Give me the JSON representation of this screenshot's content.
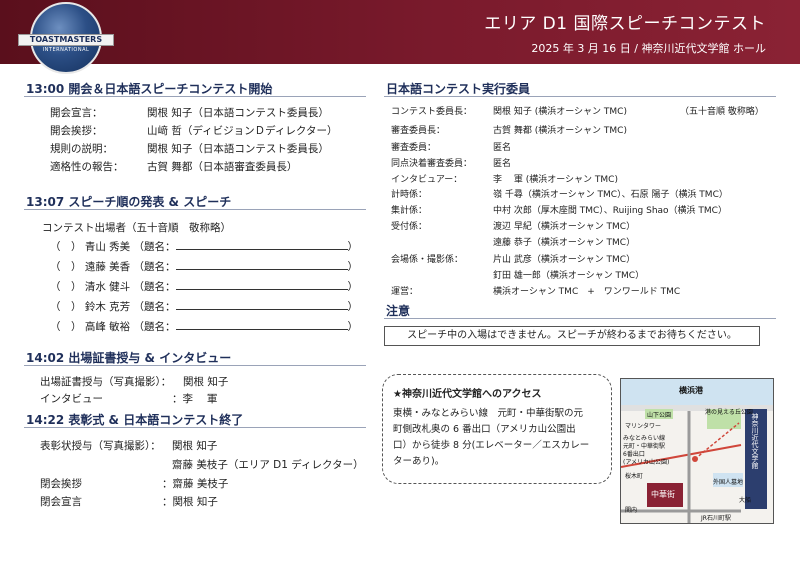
{
  "header": {
    "title": "エリア D1  国際スピーチコンテスト",
    "subtitle": "2025 年 3 月 16 日  /  神奈川近代文学館  ホール",
    "logo_text": "TOASTMASTERS",
    "logo_sub": "INTERNATIONAL"
  },
  "colors": {
    "header_bg": "#6a1424",
    "section_title": "#1f2f5a"
  },
  "opening": {
    "title": "13:00  開会＆日本語スピーチコンテスト開始",
    "items": [
      {
        "role": "開会宣言：",
        "person": "関根 知子（日本語コンテスト委員長）"
      },
      {
        "role": "開会挨拶：",
        "person": "山﨑  哲（ディビジョンＤディレクター）"
      },
      {
        "role": "規則の説明：",
        "person": "関根 知子（日本語コンテスト委員長）"
      },
      {
        "role": "適格性の報告：",
        "person": "古賀 舞都（日本語審査委員長）"
      }
    ]
  },
  "speech": {
    "title": "13:07  スピーチ順の発表 & スピーチ",
    "intro": "コンテスト出場者（五十音順　敬称略）",
    "contestants": [
      {
        "prefix": "（　）",
        "name": "青山 秀美",
        "label": "（題名：",
        "suffix": "）"
      },
      {
        "prefix": "（　）",
        "name": "遠藤 美香",
        "label": "（題名：",
        "suffix": "）"
      },
      {
        "prefix": "（　）",
        "name": "清水 健斗",
        "label": "（題名：",
        "suffix": "）"
      },
      {
        "prefix": "（　）",
        "name": "鈴木 克芳",
        "label": "（題名：",
        "suffix": "）"
      },
      {
        "prefix": "（　）",
        "name": "高峰 敏裕",
        "label": "（題名：",
        "suffix": "）"
      }
    ]
  },
  "certificate": {
    "title": "14:02 出場証書授与 & インタビュー",
    "items": [
      {
        "role": "出場証書授与（写真撮影）：",
        "person": "関根 知子"
      },
      {
        "role": "インタビュー",
        "person": "：李　  軍"
      }
    ]
  },
  "award": {
    "title": "14:22 表彰式 & 日本語コンテスト終了",
    "items": [
      {
        "role": "表彰状授与（写真撮影）：",
        "person": "関根 知子"
      },
      {
        "role": "",
        "person": "齋藤 美枝子（エリア D1 ディレクター）"
      },
      {
        "role": "閉会挨拶",
        "person": "：齋藤 美枝子"
      },
      {
        "role": "閉会宣言",
        "person": "：関根 知子"
      }
    ]
  },
  "committee": {
    "title": "日本語コンテスト実行委員",
    "note": "（五十音順  敬称略）",
    "rows": [
      {
        "role": "コンテスト委員長：",
        "names": [
          "関根 知子 (横浜オーシャン TMC)"
        ]
      },
      {
        "role": "審査委員長：",
        "names": [
          "古賀 舞都 (横浜オーシャン TMC)"
        ]
      },
      {
        "role": "審査委員：",
        "names": [
          "匿名"
        ]
      },
      {
        "role": "同点決着審査委員：",
        "names": [
          "匿名"
        ]
      },
      {
        "role": "インタビュアー：",
        "names": [
          "李　 軍 (横浜オーシャン TMC)"
        ]
      },
      {
        "role": "計時係：",
        "names": [
          "嶺 千尋（横浜オーシャン TMC）、石原 陽子（横浜 TMC）"
        ]
      },
      {
        "role": "集計係：",
        "names": [
          "中村 次郎（厚木座間 TMC）、Ruijing Shao（横浜 TMC）"
        ]
      },
      {
        "role": "受付係：",
        "names": [
          "渡辺 早紀（横浜オーシャン TMC）",
          "遠藤 恭子（横浜オーシャン TMC）"
        ]
      },
      {
        "role": "会場係・撮影係：",
        "names": [
          "片山 武彦（横浜オーシャン TMC）",
          "釘田 雄一郎（横浜オーシャン TMC）"
        ]
      },
      {
        "role": "運営：",
        "names": [
          "横浜オーシャン TMC　+　ワンワールド TMC"
        ]
      }
    ]
  },
  "notice": {
    "title": "注意",
    "text": "スピーチ中の入場はできません。スピーチが終わるまでお待ちください。"
  },
  "access": {
    "title": "★神奈川近代文学館へのアクセス",
    "lines": [
      "東横・みなとみらい線　元町・中華街駅の元",
      "町側改札奥の 6 番出口（アメリカ山公園出",
      "口）から徒歩 8 分(エレベーター／エスカレー",
      "ターあり)。"
    ]
  },
  "map": {
    "labels": {
      "top": "横浜港",
      "park": "山下公園",
      "marine": "マリンタワー",
      "hill": "港の見える丘公園",
      "station1": "みなとみらい線",
      "station2": "元町・中華街駅",
      "exit": "6番出口",
      "exit_sub": "(アメリカ山公園)",
      "sakuragi": "桜木町",
      "chinatown": "中華街",
      "kannai": "関内",
      "cemetery": "外国人墓地",
      "ohka": "大船",
      "ishikawa": "JR石川町駅",
      "museum": "神奈川近代文学館"
    }
  }
}
